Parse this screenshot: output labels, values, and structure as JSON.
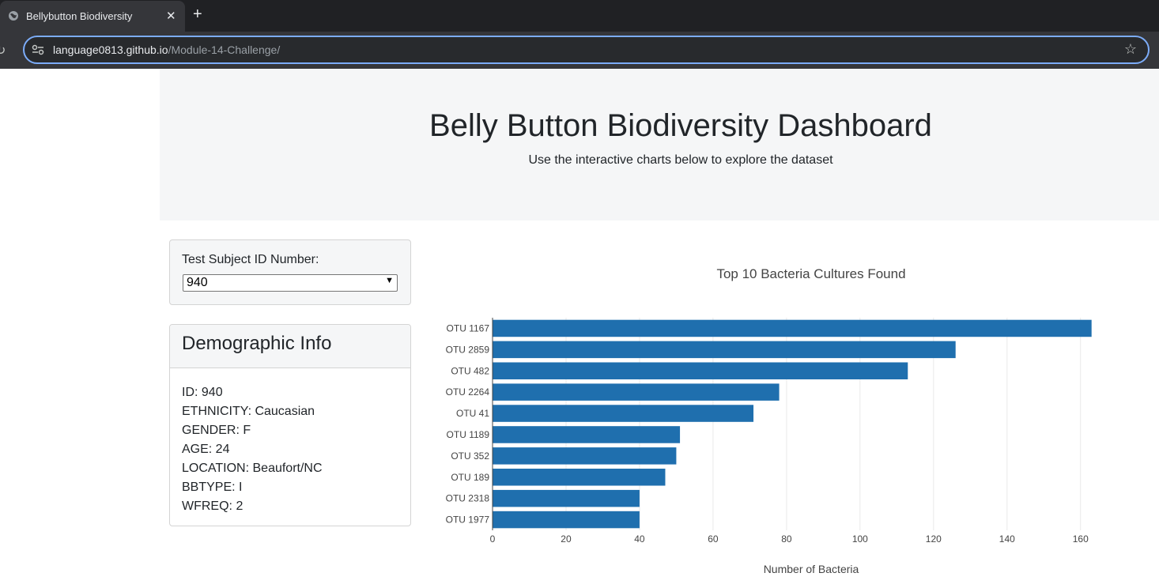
{
  "browser": {
    "tab_title": "Bellybutton Biodiversity",
    "url_host": "language0813.github.io",
    "url_path": "/Module-14-Challenge/"
  },
  "header": {
    "title": "Belly Button Biodiversity Dashboard",
    "subtitle": "Use the interactive charts below to explore the dataset"
  },
  "selector": {
    "label": "Test Subject ID Number:",
    "selected": "940"
  },
  "demographics": {
    "title": "Demographic Info",
    "items": [
      "ID: 940",
      "ETHNICITY: Caucasian",
      "GENDER: F",
      "AGE: 24",
      "LOCATION: Beaufort/NC",
      "BBTYPE: I",
      "WFREQ: 2"
    ]
  },
  "colors": {
    "bar": "#1f6fae",
    "grid": "#e9e9e9"
  },
  "chart_data": {
    "type": "bar",
    "orientation": "horizontal",
    "title": "Top 10 Bacteria Cultures Found",
    "xlabel": "Number of Bacteria",
    "ylabel": "",
    "categories": [
      "OTU 1167",
      "OTU 2859",
      "OTU 482",
      "OTU 2264",
      "OTU 41",
      "OTU 1189",
      "OTU 352",
      "OTU 189",
      "OTU 2318",
      "OTU 1977"
    ],
    "values": [
      163,
      126,
      113,
      78,
      71,
      51,
      50,
      47,
      40,
      40
    ],
    "xlim": [
      0,
      165
    ],
    "xticks": [
      0,
      20,
      40,
      60,
      80,
      100,
      120,
      140,
      160
    ],
    "grid": true
  }
}
